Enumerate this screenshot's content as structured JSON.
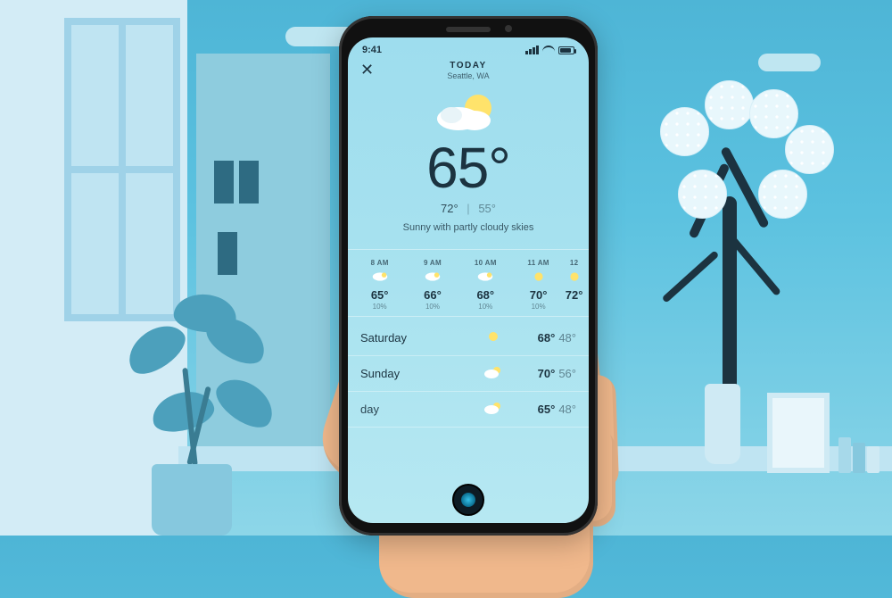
{
  "statusbar": {
    "time": "9:41"
  },
  "header": {
    "title": "TODAY",
    "location": "Seattle, WA",
    "close": "✕"
  },
  "current": {
    "temp": "65°",
    "high": "72°",
    "low": "55°",
    "condition": "Sunny with partly cloudy skies"
  },
  "hourly": [
    {
      "time": "8 AM",
      "temp": "65°",
      "precip": "10%"
    },
    {
      "time": "9 AM",
      "temp": "66°",
      "precip": "10%"
    },
    {
      "time": "10 AM",
      "temp": "68°",
      "precip": "10%"
    },
    {
      "time": "11 AM",
      "temp": "70°",
      "precip": "10%"
    },
    {
      "time": "12",
      "temp": "72°",
      "precip": ""
    }
  ],
  "daily": [
    {
      "day": "Saturday",
      "high": "68°",
      "low": "48°"
    },
    {
      "day": "Sunday",
      "high": "70°",
      "low": "56°"
    },
    {
      "day": "day",
      "high": "65°",
      "low": "48°"
    }
  ]
}
